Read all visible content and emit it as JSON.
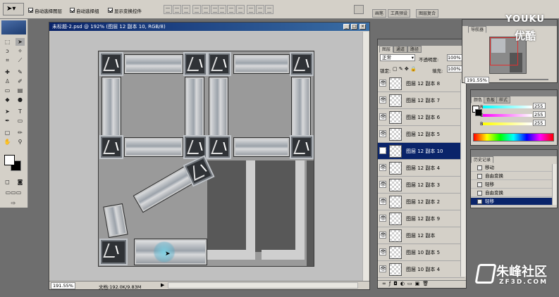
{
  "options_bar": {
    "auto_select_layer": "自动选择图层",
    "auto_select_group": "自动选择组",
    "show_transform_controls": "显示变换控件"
  },
  "panel_tabs_top": [
    "画笔",
    "工具预设",
    "图层复合"
  ],
  "document": {
    "title": "未标题-2.psd @ 192% (图层 12 副本 10, RGB/8)",
    "zoom": "191.55%",
    "doc_size": "文档:192.0K/9.83M"
  },
  "layers_panel": {
    "tabs": [
      "图层",
      "通道",
      "路径"
    ],
    "blend_mode": "正常",
    "opacity_label": "不透明度:",
    "opacity_value": "100%",
    "lock_label": "锁定:",
    "fill_label": "填充:",
    "fill_value": "100%",
    "layers": [
      {
        "name": "图层 12 副本 8",
        "selected": false
      },
      {
        "name": "图层 12 副本 7",
        "selected": false
      },
      {
        "name": "图层 12 副本 6",
        "selected": false
      },
      {
        "name": "图层 12 副本 5",
        "selected": false
      },
      {
        "name": "图层 12 副本 10",
        "selected": true
      },
      {
        "name": "图层 12 副本 4",
        "selected": false
      },
      {
        "name": "图层 12 副本 3",
        "selected": false
      },
      {
        "name": "图层 12 副本 2",
        "selected": false
      },
      {
        "name": "图层 12 副本 9",
        "selected": false
      },
      {
        "name": "图层 12 副本",
        "selected": false
      },
      {
        "name": "图层 10 副本 5",
        "selected": false
      },
      {
        "name": "图层 10 副本 4",
        "selected": false
      }
    ]
  },
  "navigator_panel": {
    "tab": "导航器",
    "zoom": "191.55%"
  },
  "color_panel": {
    "tabs": [
      "颜色",
      "色板",
      "样式"
    ],
    "r": "255",
    "g": "255",
    "b": "255"
  },
  "history_panel": {
    "tab": "历史记录",
    "items": [
      {
        "name": "移动",
        "selected": false
      },
      {
        "name": "自由变换",
        "selected": false
      },
      {
        "name": "轻移",
        "selected": false
      },
      {
        "name": "自由变换",
        "selected": false
      },
      {
        "name": "轻移",
        "selected": true
      }
    ]
  },
  "watermarks": {
    "youku_top": "YOUKU",
    "youku_bottom": "优酷",
    "zf3d_cn": "朱峰社区",
    "zf3d_url": "ZF3D.COM"
  },
  "colors": {
    "selection": "#0a246a",
    "panel_bg": "#d4d0c8",
    "workspace": "#6e6e6e"
  }
}
